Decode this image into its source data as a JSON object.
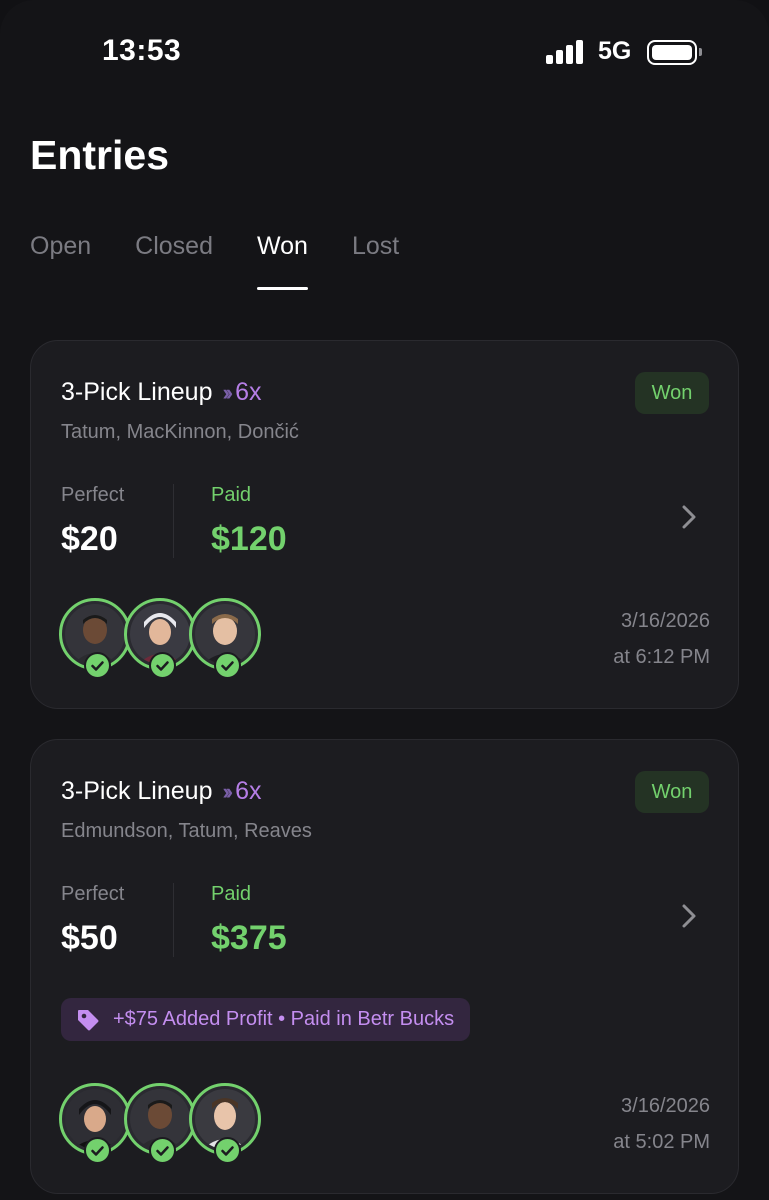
{
  "status_bar": {
    "time": "13:53",
    "network": "5G"
  },
  "page": {
    "title": "Entries"
  },
  "tabs": [
    {
      "label": "Open"
    },
    {
      "label": "Closed"
    },
    {
      "label": "Won",
      "active": true
    },
    {
      "label": "Lost"
    }
  ],
  "entries": [
    {
      "title": "3-Pick Lineup",
      "multiplier": "6x",
      "status": "Won",
      "players": "Tatum, MacKinnon, Dončić",
      "stake_label": "Perfect",
      "stake_value": "$20",
      "paid_label": "Paid",
      "paid_value": "$120",
      "date": "3/16/2026",
      "time": "at 6:12 PM"
    },
    {
      "title": "3-Pick Lineup",
      "multiplier": "6x",
      "status": "Won",
      "players": "Edmundson, Tatum, Reaves",
      "stake_label": "Perfect",
      "stake_value": "$50",
      "paid_label": "Paid",
      "paid_value": "$375",
      "promo": "+$75 Added Profit • Paid in Betr Bucks",
      "date": "3/16/2026",
      "time": "at 5:02 PM"
    }
  ],
  "colors": {
    "won_green": "#73d16d",
    "accent_purple": "#b57ee6",
    "background": "#141417",
    "card": "#1c1c20"
  },
  "icons": [
    "signal-icon",
    "battery-icon",
    "chevron-right-icon",
    "tag-icon",
    "check-icon"
  ]
}
